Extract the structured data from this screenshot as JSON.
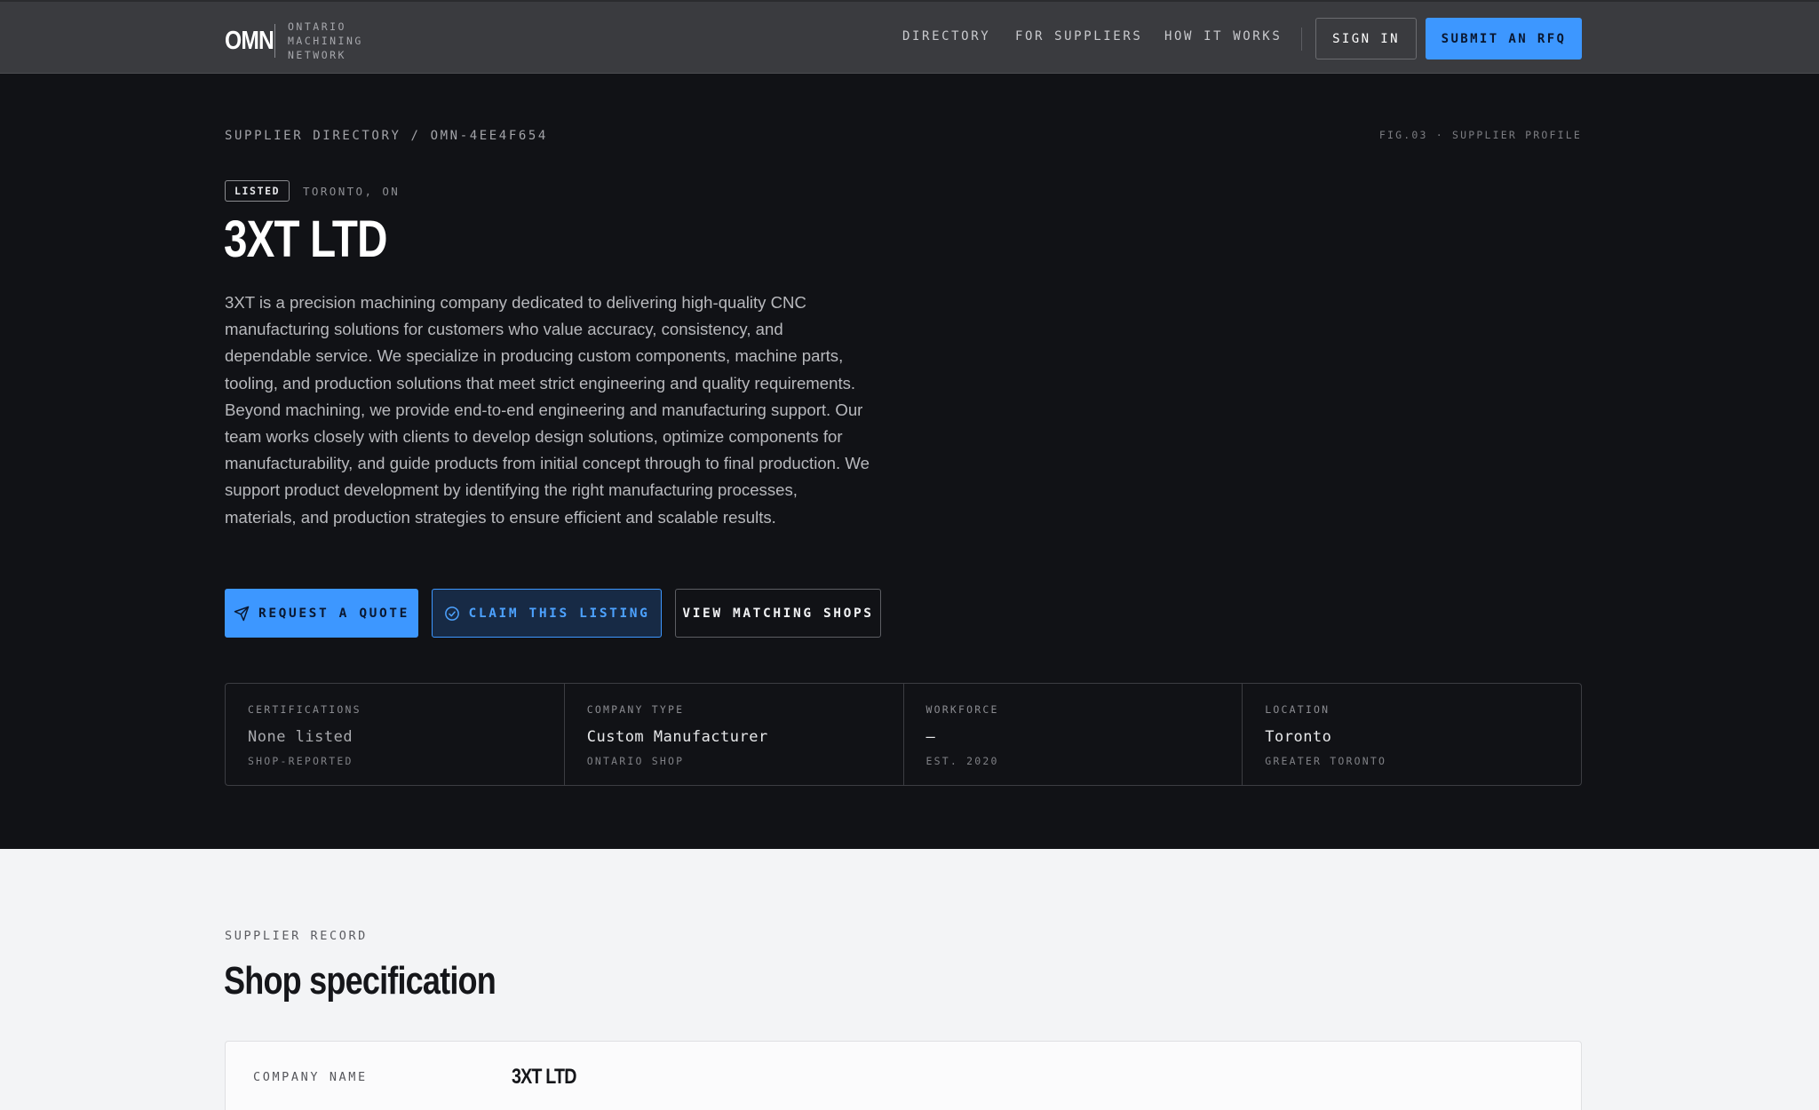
{
  "header": {
    "logo_mark": "OMN",
    "logo_lines": [
      "ONTARIO",
      "MACHINING",
      "NETWORK"
    ],
    "nav": [
      "DIRECTORY",
      "FOR SUPPLIERS",
      "HOW IT WORKS"
    ],
    "sign_in": "SIGN IN",
    "submit_rfq": "SUBMIT AN RFQ"
  },
  "hero": {
    "breadcrumb": "SUPPLIER DIRECTORY / OMN-4EE4F654",
    "fig_label": "FIG.03 · SUPPLIER PROFILE",
    "badge": "LISTED",
    "location": "TORONTO, ON",
    "title": "3XT LTD",
    "description": "3XT is a precision machining company dedicated to delivering high-quality CNC manufacturing solutions for customers who value accuracy, consistency, and dependable service. We specialize in producing custom components, machine parts, tooling, and production solutions that meet strict engineering and quality requirements. Beyond machining, we provide end-to-end engineering and manufacturing support. Our team works closely with clients to develop design solutions, optimize components for manufacturability, and guide products from initial concept through to final production. We support product development by identifying the right manufacturing processes, materials, and production strategies to ensure efficient and scalable results.",
    "buttons": {
      "quote": "REQUEST A QUOTE",
      "claim": "CLAIM THIS LISTING",
      "view": "VIEW MATCHING SHOPS"
    },
    "stats": [
      {
        "label": "CERTIFICATIONS",
        "value": "None listed",
        "sub": "SHOP-REPORTED"
      },
      {
        "label": "COMPANY TYPE",
        "value": "Custom Manufacturer",
        "sub": "ONTARIO SHOP"
      },
      {
        "label": "WORKFORCE",
        "value": "—",
        "sub": "EST. 2020"
      },
      {
        "label": "LOCATION",
        "value": "Toronto",
        "sub": "GREATER TORONTO"
      }
    ]
  },
  "record": {
    "label": "SUPPLIER RECORD",
    "title": "Shop specification",
    "rows": [
      {
        "key": "COMPANY NAME",
        "value": "3XT LTD"
      }
    ]
  },
  "colors": {
    "accent": "#3d97ff",
    "dark_bg": "#111216",
    "header_bg": "#3a3b3f",
    "light_bg": "#f3f4f6"
  }
}
